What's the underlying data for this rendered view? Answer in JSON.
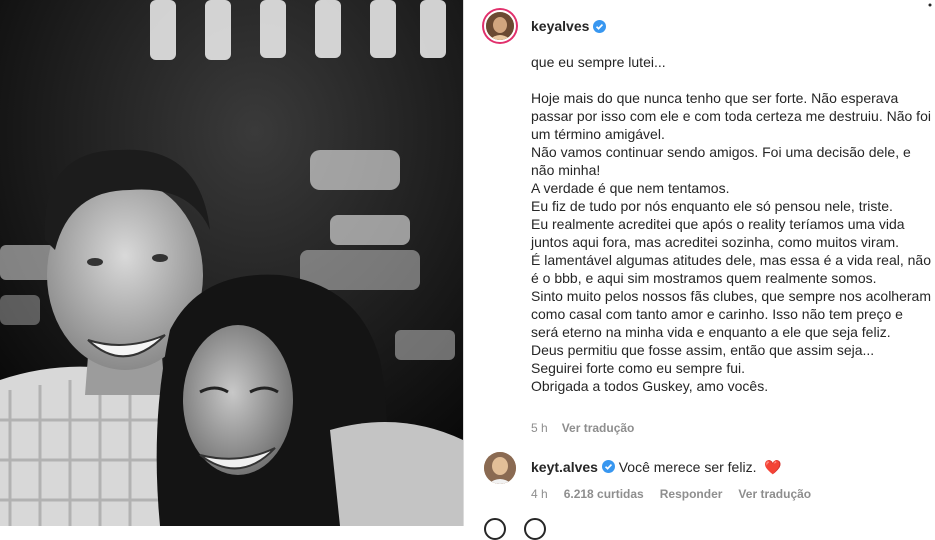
{
  "post": {
    "username": "keyalves",
    "verified_icon": "verified-badge-icon",
    "more_icon": "more-options-icon"
  },
  "caption": {
    "lines": [
      "que eu sempre lutei...",
      "",
      "Hoje mais do que nunca tenho que ser forte. Não esperava passar por isso com ele e com toda certeza me destruiu. Não foi um término amigável.",
      "Não vamos continuar sendo amigos. Foi uma decisão dele, e não minha!",
      "A verdade é que nem tentamos.",
      "Eu fiz de tudo por nós enquanto ele só pensou nele, triste.",
      "Eu realmente acreditei que após o reality teríamos uma vida juntos aqui fora, mas acreditei sozinha, como muitos viram.",
      "É lamentável algumas atitudes dele, mas essa é a vida real, não é o bbb, e aqui sim mostramos quem realmente somos.",
      "Sinto muito pelos nossos fãs clubes, que sempre nos acolheram como casal com tanto amor e carinho. Isso não tem preço e será eterno na minha vida e enquanto a ele que seja feliz.",
      "Deus permitiu que fosse assim, então que assim seja...",
      "Seguirei forte como eu sempre fui.",
      "Obrigada a todos Guskey, amo vocês."
    ],
    "time": "5 h",
    "translate": "Ver tradução"
  },
  "comment": {
    "username": "keyt.alves",
    "text": "Você merece ser feliz.",
    "emoji": "❤️",
    "time": "4 h",
    "likes": "6.218 curtidas",
    "reply": "Responder",
    "translate": "Ver tradução"
  }
}
